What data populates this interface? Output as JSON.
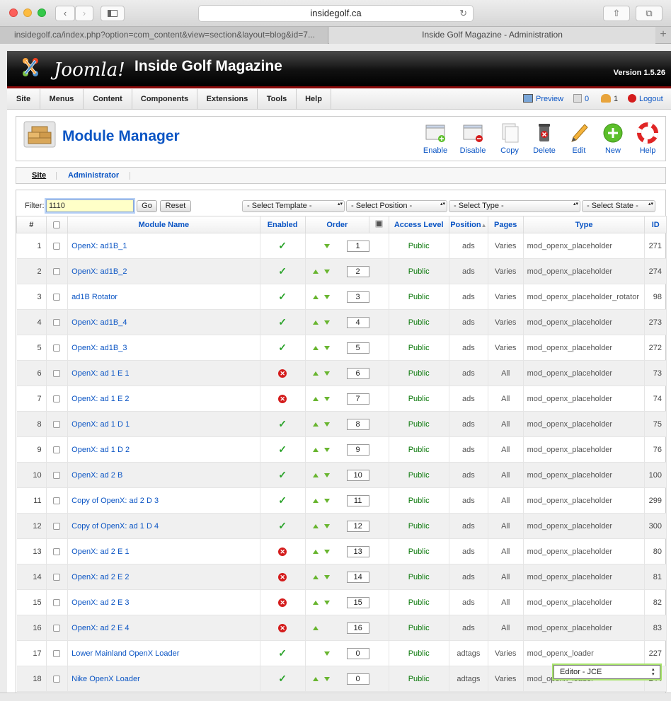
{
  "browser": {
    "url": "insidegolf.ca",
    "tabs": [
      {
        "label": "insidegolf.ca/index.php?option=com_content&view=section&layout=blog&id=7..."
      },
      {
        "label": "Inside Golf Magazine - Administration"
      }
    ],
    "new_tab": "+"
  },
  "header": {
    "logo_text": "Joomla!",
    "site_name": "Inside Golf Magazine",
    "version": "Version 1.5.26"
  },
  "menu": {
    "items": [
      "Site",
      "Menus",
      "Content",
      "Components",
      "Extensions",
      "Tools",
      "Help"
    ],
    "preview": "Preview",
    "messages": "0",
    "users": "1",
    "logout": "Logout"
  },
  "toolbar": {
    "title": "Module Manager",
    "buttons": [
      "Enable",
      "Disable",
      "Copy",
      "Delete",
      "Edit",
      "New",
      "Help"
    ]
  },
  "subnav": {
    "site": "Site",
    "administrator": "Administrator"
  },
  "filter": {
    "label": "Filter:",
    "value": "1110",
    "go": "Go",
    "reset": "Reset",
    "template": "- Select Template -",
    "position": "- Select Position -",
    "type": "- Select Type -",
    "state": "- Select State -"
  },
  "table": {
    "headers": {
      "num": "#",
      "name": "Module Name",
      "enabled": "Enabled",
      "order": "Order",
      "access": "Access Level",
      "position": "Position",
      "pages": "Pages",
      "type": "Type",
      "id": "ID"
    },
    "rows": [
      {
        "num": "1",
        "name": "OpenX: ad1B_1",
        "enabled": true,
        "up": false,
        "down": true,
        "order": "1",
        "access": "Public",
        "position": "ads",
        "pages": "Varies",
        "type": "mod_openx_placeholder",
        "id": "271"
      },
      {
        "num": "2",
        "name": "OpenX: ad1B_2",
        "enabled": true,
        "up": true,
        "down": true,
        "order": "2",
        "access": "Public",
        "position": "ads",
        "pages": "Varies",
        "type": "mod_openx_placeholder",
        "id": "274"
      },
      {
        "num": "3",
        "name": "ad1B Rotator",
        "enabled": true,
        "up": true,
        "down": true,
        "order": "3",
        "access": "Public",
        "position": "ads",
        "pages": "Varies",
        "type": "mod_openx_placeholder_rotator",
        "id": "98"
      },
      {
        "num": "4",
        "name": "OpenX: ad1B_4",
        "enabled": true,
        "up": true,
        "down": true,
        "order": "4",
        "access": "Public",
        "position": "ads",
        "pages": "Varies",
        "type": "mod_openx_placeholder",
        "id": "273"
      },
      {
        "num": "5",
        "name": "OpenX: ad1B_3",
        "enabled": true,
        "up": true,
        "down": true,
        "order": "5",
        "access": "Public",
        "position": "ads",
        "pages": "Varies",
        "type": "mod_openx_placeholder",
        "id": "272"
      },
      {
        "num": "6",
        "name": "OpenX: ad 1 E 1",
        "enabled": false,
        "up": true,
        "down": true,
        "order": "6",
        "access": "Public",
        "position": "ads",
        "pages": "All",
        "type": "mod_openx_placeholder",
        "id": "73"
      },
      {
        "num": "7",
        "name": "OpenX: ad 1 E 2",
        "enabled": false,
        "up": true,
        "down": true,
        "order": "7",
        "access": "Public",
        "position": "ads",
        "pages": "All",
        "type": "mod_openx_placeholder",
        "id": "74"
      },
      {
        "num": "8",
        "name": "OpenX: ad 1 D 1",
        "enabled": true,
        "up": true,
        "down": true,
        "order": "8",
        "access": "Public",
        "position": "ads",
        "pages": "All",
        "type": "mod_openx_placeholder",
        "id": "75"
      },
      {
        "num": "9",
        "name": "OpenX: ad 1 D 2",
        "enabled": true,
        "up": true,
        "down": true,
        "order": "9",
        "access": "Public",
        "position": "ads",
        "pages": "All",
        "type": "mod_openx_placeholder",
        "id": "76"
      },
      {
        "num": "10",
        "name": "OpenX: ad 2 B",
        "enabled": true,
        "up": true,
        "down": true,
        "order": "10",
        "access": "Public",
        "position": "ads",
        "pages": "All",
        "type": "mod_openx_placeholder",
        "id": "100"
      },
      {
        "num": "11",
        "name": "Copy of OpenX: ad 2 D 3",
        "enabled": true,
        "up": true,
        "down": true,
        "order": "11",
        "access": "Public",
        "position": "ads",
        "pages": "All",
        "type": "mod_openx_placeholder",
        "id": "299"
      },
      {
        "num": "12",
        "name": "Copy of OpenX: ad 1 D 4",
        "enabled": true,
        "up": true,
        "down": true,
        "order": "12",
        "access": "Public",
        "position": "ads",
        "pages": "All",
        "type": "mod_openx_placeholder",
        "id": "300"
      },
      {
        "num": "13",
        "name": "OpenX: ad 2 E 1",
        "enabled": false,
        "up": true,
        "down": true,
        "order": "13",
        "access": "Public",
        "position": "ads",
        "pages": "All",
        "type": "mod_openx_placeholder",
        "id": "80"
      },
      {
        "num": "14",
        "name": "OpenX: ad 2 E 2",
        "enabled": false,
        "up": true,
        "down": true,
        "order": "14",
        "access": "Public",
        "position": "ads",
        "pages": "All",
        "type": "mod_openx_placeholder",
        "id": "81"
      },
      {
        "num": "15",
        "name": "OpenX: ad 2 E 3",
        "enabled": false,
        "up": true,
        "down": true,
        "order": "15",
        "access": "Public",
        "position": "ads",
        "pages": "All",
        "type": "mod_openx_placeholder",
        "id": "82"
      },
      {
        "num": "16",
        "name": "OpenX: ad 2 E 4",
        "enabled": false,
        "up": true,
        "down": false,
        "order": "16",
        "access": "Public",
        "position": "ads",
        "pages": "All",
        "type": "mod_openx_placeholder",
        "id": "83"
      },
      {
        "num": "17",
        "name": "Lower Mainland OpenX Loader",
        "enabled": true,
        "up": false,
        "down": true,
        "order": "0",
        "access": "Public",
        "position": "adtags",
        "pages": "Varies",
        "type": "mod_openx_loader",
        "id": "227"
      },
      {
        "num": "18",
        "name": "Nike OpenX Loader",
        "enabled": true,
        "up": true,
        "down": true,
        "order": "0",
        "access": "Public",
        "position": "adtags",
        "pages": "Varies",
        "type": "mod_openx_loader",
        "id": "244"
      }
    ]
  },
  "popup": {
    "label": "Editor - JCE"
  },
  "colors": {
    "link": "#0b55c4",
    "public": "#087708",
    "enabled": "#2aa32a",
    "disabled": "#d41c1c",
    "header_rule": "#8b0a0a"
  }
}
